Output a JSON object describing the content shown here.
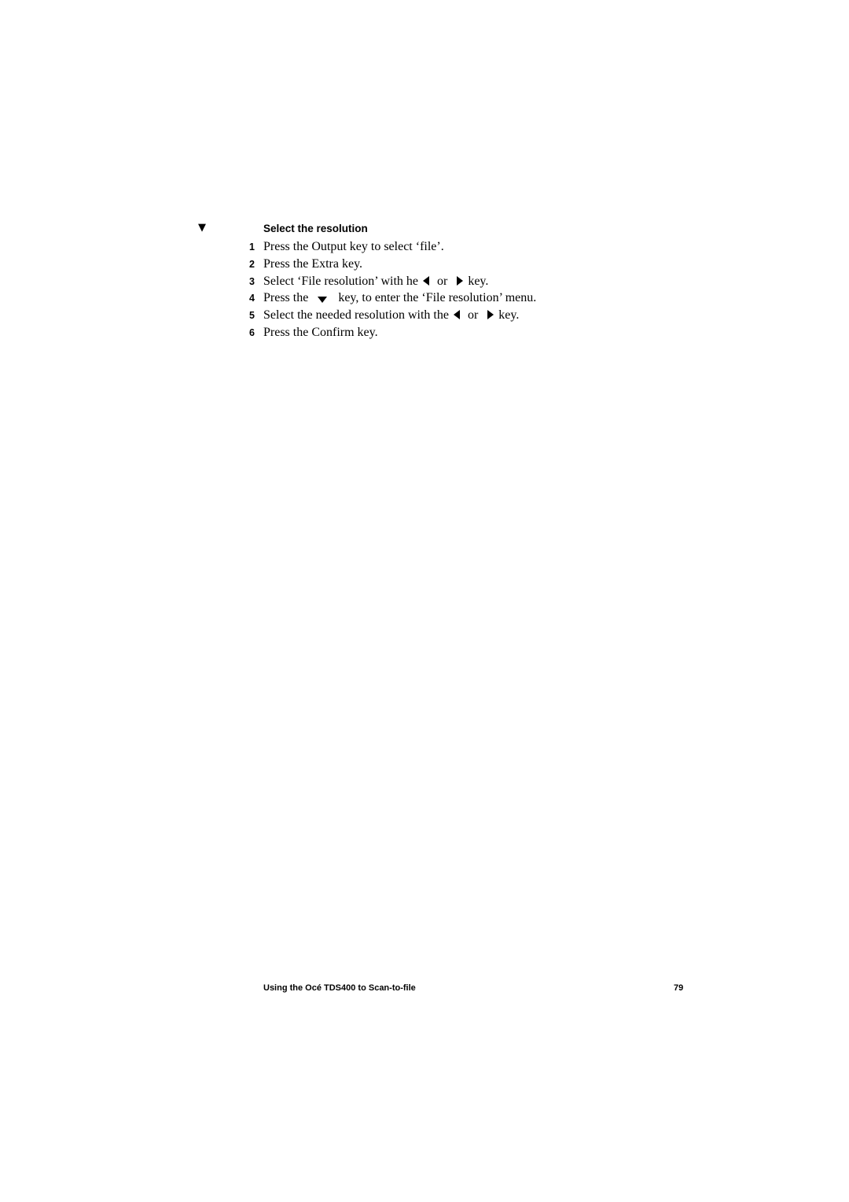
{
  "section": {
    "marker_icon": "down-triangle-icon",
    "title": "Select the resolution"
  },
  "steps": [
    {
      "num": "1",
      "text": "Press the Output key to select ‘file’."
    },
    {
      "num": "2",
      "text": "Press the Extra key."
    },
    {
      "num": "3",
      "text_a": "Select ‘File resolution’ with he",
      "mid": "or",
      "text_b": "key.",
      "icons": [
        "arrow-left-key-icon",
        "arrow-right-key-icon"
      ]
    },
    {
      "num": "4",
      "text_a": "Press the",
      "text_b": "key, to enter the ‘File resolution’ menu.",
      "icons": [
        "arrow-down-key-icon"
      ]
    },
    {
      "num": "5",
      "text_a": "Select the needed resolution with the",
      "mid": "or",
      "text_b": "key.",
      "icons": [
        "arrow-left-key-icon",
        "arrow-right-key-icon"
      ]
    },
    {
      "num": "6",
      "text": "Press the Confirm key."
    }
  ],
  "footer": {
    "title": "Using the Océ TDS400 to Scan-to-file",
    "page_number": "79"
  }
}
